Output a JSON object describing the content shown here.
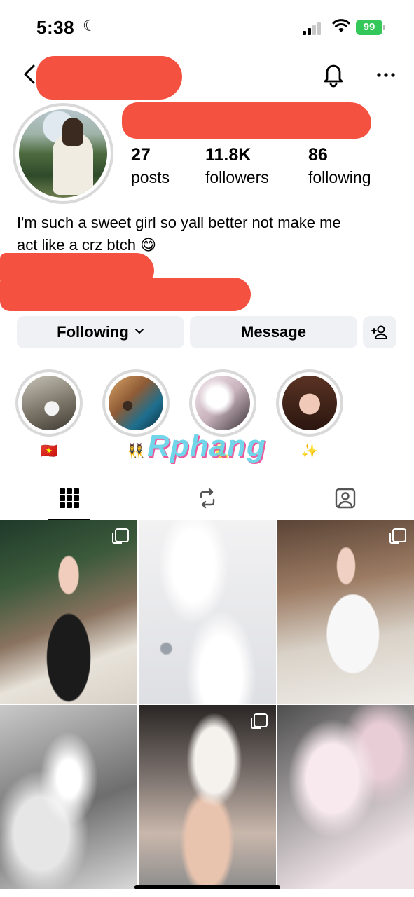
{
  "status_bar": {
    "time": "5:38",
    "battery": "99"
  },
  "profile": {
    "stats": [
      {
        "value": "27",
        "label": "posts"
      },
      {
        "value": "11.8K",
        "label": "followers"
      },
      {
        "value": "86",
        "label": "following"
      }
    ],
    "bio_line1": "I'm such a sweet girl so yall better not make me",
    "bio_line2": "act like a crz btch 😋"
  },
  "actions": {
    "following_label": "Following",
    "message_label": "Message"
  },
  "highlights": [
    {
      "label": "🇻🇳"
    },
    {
      "label": "👯‍♀️"
    },
    {
      "label": "🌜"
    },
    {
      "label": "✨"
    }
  ],
  "watermark": "Rphang",
  "tabs": [
    {
      "icon": "grid-icon",
      "active": true
    },
    {
      "icon": "reels-remix-icon",
      "active": false
    },
    {
      "icon": "tagged-icon",
      "active": false
    }
  ],
  "colors": {
    "redaction": "#f45141",
    "button_bg": "#eff1f5",
    "battery": "#34c759",
    "highlight_ring": "#d9d9d9"
  }
}
